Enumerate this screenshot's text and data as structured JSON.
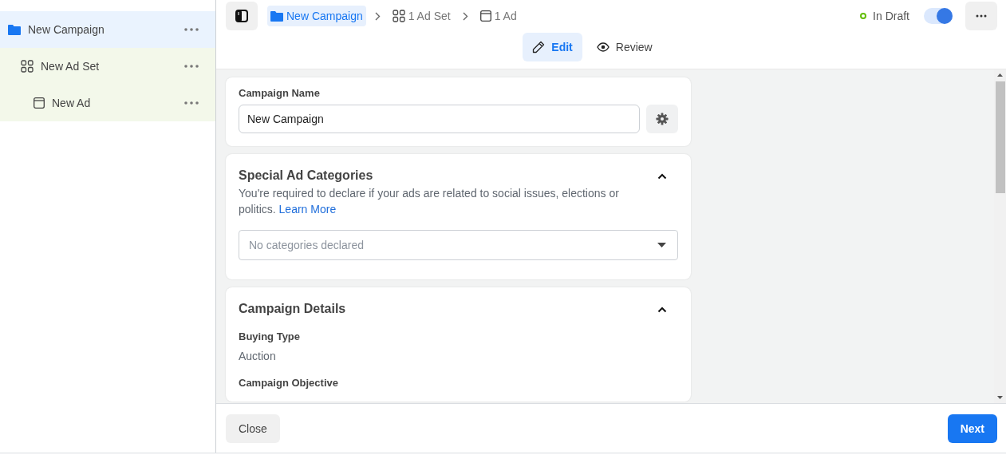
{
  "sidebar": {
    "tree": [
      {
        "kind": "campaign",
        "label": "New Campaign",
        "selected": true,
        "children": [
          {
            "kind": "adset",
            "label": "New Ad Set",
            "selected": false,
            "children": [
              {
                "kind": "ad",
                "label": "New Ad",
                "selected": false
              }
            ]
          }
        ]
      }
    ]
  },
  "breadcrumb": [
    {
      "kind": "campaign",
      "label": "New Campaign",
      "selected": true
    },
    {
      "kind": "adset",
      "label": "1 Ad Set",
      "selected": false
    },
    {
      "kind": "ad",
      "label": "1 Ad",
      "selected": false
    }
  ],
  "modes": [
    {
      "kind": "edit",
      "label": "Edit",
      "selected": true
    },
    {
      "kind": "review",
      "label": "Review",
      "selected": false
    }
  ],
  "status": {
    "label": "In Draft",
    "color": "#63be09",
    "toggle_on": true
  },
  "campaign_name": {
    "label": "Campaign Name",
    "value": "New Campaign"
  },
  "special_ad_categories": {
    "title": "Special Ad Categories",
    "expanded": true,
    "description": "You're required to declare if your ads are related to social issues, elections or politics.",
    "link": "Learn More",
    "placeholder": "No categories declared"
  },
  "campaign_details": {
    "title": "Campaign Details",
    "expanded": true,
    "fields": [
      {
        "label": "Buying Type",
        "value": "Auction"
      },
      {
        "label": "Campaign Objective"
      }
    ]
  },
  "footer": {
    "close": "Close",
    "next": "Next"
  }
}
